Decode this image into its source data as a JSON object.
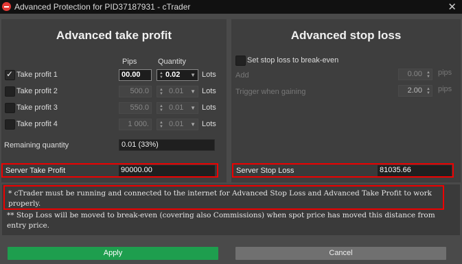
{
  "window": {
    "title": "Advanced Protection for PID37187931 - cTrader",
    "close_glyph": "✕"
  },
  "take_profit": {
    "heading": "Advanced take profit",
    "col_pips": "Pips",
    "col_quantity": "Quantity",
    "lots_label": "Lots",
    "rows": [
      {
        "label": "Take profit 1",
        "checked": true,
        "pips": "00.00",
        "quantity": "0.02"
      },
      {
        "label": "Take profit 2",
        "checked": false,
        "pips": "500.0",
        "quantity": "0.01"
      },
      {
        "label": "Take profit 3",
        "checked": false,
        "pips": "550.0",
        "quantity": "0.01"
      },
      {
        "label": "Take profit 4",
        "checked": false,
        "pips": "1 000.",
        "quantity": "0.01"
      }
    ],
    "remaining_label": "Remaining quantity",
    "remaining_value": "0.01 (33%)",
    "server_label": "Server Take Profit",
    "server_value": "90000.00"
  },
  "stop_loss": {
    "heading": "Advanced stop loss",
    "breakeven_label": "Set stop loss to break-even",
    "breakeven_checked": false,
    "add_label": "Add",
    "add_value": "0.00",
    "trigger_label": "Trigger when gaining",
    "trigger_value": "2.00",
    "pips_unit": "pips",
    "server_label": "Server Stop Loss",
    "server_value": "81035.66"
  },
  "notes": {
    "note1": "* cTrader must be running and connected to the internet for Advanced Stop Loss and Advanced Take Profit to work properly.",
    "note2": "** Stop Loss will be moved to break-even (covering also Commissions) when spot price has moved this distance from entry price."
  },
  "buttons": {
    "apply": "Apply",
    "cancel": "Cancel"
  },
  "colors": {
    "apply": "#1e9e4e",
    "highlight": "#e00000",
    "logo": "#e53935"
  }
}
